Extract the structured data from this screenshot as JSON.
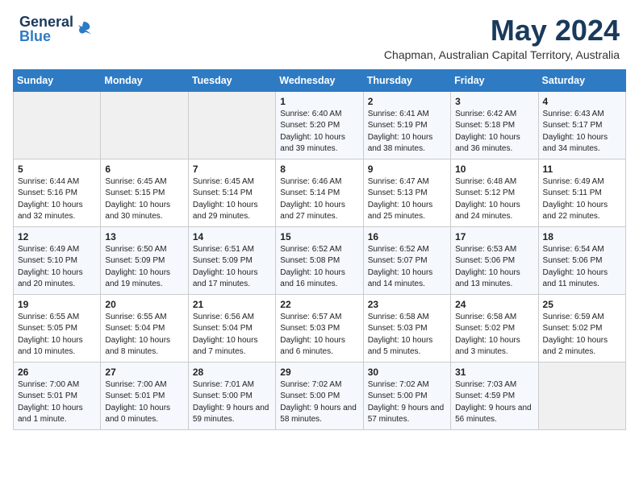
{
  "header": {
    "logo_general": "General",
    "logo_blue": "Blue",
    "month_year": "May 2024",
    "location": "Chapman, Australian Capital Territory, Australia"
  },
  "calendar": {
    "day_headers": [
      "Sunday",
      "Monday",
      "Tuesday",
      "Wednesday",
      "Thursday",
      "Friday",
      "Saturday"
    ],
    "weeks": [
      [
        {
          "day": "",
          "content": ""
        },
        {
          "day": "",
          "content": ""
        },
        {
          "day": "",
          "content": ""
        },
        {
          "day": "1",
          "content": "Sunrise: 6:40 AM\nSunset: 5:20 PM\nDaylight: 10 hours\nand 39 minutes."
        },
        {
          "day": "2",
          "content": "Sunrise: 6:41 AM\nSunset: 5:19 PM\nDaylight: 10 hours\nand 38 minutes."
        },
        {
          "day": "3",
          "content": "Sunrise: 6:42 AM\nSunset: 5:18 PM\nDaylight: 10 hours\nand 36 minutes."
        },
        {
          "day": "4",
          "content": "Sunrise: 6:43 AM\nSunset: 5:17 PM\nDaylight: 10 hours\nand 34 minutes."
        }
      ],
      [
        {
          "day": "5",
          "content": "Sunrise: 6:44 AM\nSunset: 5:16 PM\nDaylight: 10 hours\nand 32 minutes."
        },
        {
          "day": "6",
          "content": "Sunrise: 6:45 AM\nSunset: 5:15 PM\nDaylight: 10 hours\nand 30 minutes."
        },
        {
          "day": "7",
          "content": "Sunrise: 6:45 AM\nSunset: 5:14 PM\nDaylight: 10 hours\nand 29 minutes."
        },
        {
          "day": "8",
          "content": "Sunrise: 6:46 AM\nSunset: 5:14 PM\nDaylight: 10 hours\nand 27 minutes."
        },
        {
          "day": "9",
          "content": "Sunrise: 6:47 AM\nSunset: 5:13 PM\nDaylight: 10 hours\nand 25 minutes."
        },
        {
          "day": "10",
          "content": "Sunrise: 6:48 AM\nSunset: 5:12 PM\nDaylight: 10 hours\nand 24 minutes."
        },
        {
          "day": "11",
          "content": "Sunrise: 6:49 AM\nSunset: 5:11 PM\nDaylight: 10 hours\nand 22 minutes."
        }
      ],
      [
        {
          "day": "12",
          "content": "Sunrise: 6:49 AM\nSunset: 5:10 PM\nDaylight: 10 hours\nand 20 minutes."
        },
        {
          "day": "13",
          "content": "Sunrise: 6:50 AM\nSunset: 5:09 PM\nDaylight: 10 hours\nand 19 minutes."
        },
        {
          "day": "14",
          "content": "Sunrise: 6:51 AM\nSunset: 5:09 PM\nDaylight: 10 hours\nand 17 minutes."
        },
        {
          "day": "15",
          "content": "Sunrise: 6:52 AM\nSunset: 5:08 PM\nDaylight: 10 hours\nand 16 minutes."
        },
        {
          "day": "16",
          "content": "Sunrise: 6:52 AM\nSunset: 5:07 PM\nDaylight: 10 hours\nand 14 minutes."
        },
        {
          "day": "17",
          "content": "Sunrise: 6:53 AM\nSunset: 5:06 PM\nDaylight: 10 hours\nand 13 minutes."
        },
        {
          "day": "18",
          "content": "Sunrise: 6:54 AM\nSunset: 5:06 PM\nDaylight: 10 hours\nand 11 minutes."
        }
      ],
      [
        {
          "day": "19",
          "content": "Sunrise: 6:55 AM\nSunset: 5:05 PM\nDaylight: 10 hours\nand 10 minutes."
        },
        {
          "day": "20",
          "content": "Sunrise: 6:55 AM\nSunset: 5:04 PM\nDaylight: 10 hours\nand 8 minutes."
        },
        {
          "day": "21",
          "content": "Sunrise: 6:56 AM\nSunset: 5:04 PM\nDaylight: 10 hours\nand 7 minutes."
        },
        {
          "day": "22",
          "content": "Sunrise: 6:57 AM\nSunset: 5:03 PM\nDaylight: 10 hours\nand 6 minutes."
        },
        {
          "day": "23",
          "content": "Sunrise: 6:58 AM\nSunset: 5:03 PM\nDaylight: 10 hours\nand 5 minutes."
        },
        {
          "day": "24",
          "content": "Sunrise: 6:58 AM\nSunset: 5:02 PM\nDaylight: 10 hours\nand 3 minutes."
        },
        {
          "day": "25",
          "content": "Sunrise: 6:59 AM\nSunset: 5:02 PM\nDaylight: 10 hours\nand 2 minutes."
        }
      ],
      [
        {
          "day": "26",
          "content": "Sunrise: 7:00 AM\nSunset: 5:01 PM\nDaylight: 10 hours\nand 1 minute."
        },
        {
          "day": "27",
          "content": "Sunrise: 7:00 AM\nSunset: 5:01 PM\nDaylight: 10 hours\nand 0 minutes."
        },
        {
          "day": "28",
          "content": "Sunrise: 7:01 AM\nSunset: 5:00 PM\nDaylight: 9 hours\nand 59 minutes."
        },
        {
          "day": "29",
          "content": "Sunrise: 7:02 AM\nSunset: 5:00 PM\nDaylight: 9 hours\nand 58 minutes."
        },
        {
          "day": "30",
          "content": "Sunrise: 7:02 AM\nSunset: 5:00 PM\nDaylight: 9 hours\nand 57 minutes."
        },
        {
          "day": "31",
          "content": "Sunrise: 7:03 AM\nSunset: 4:59 PM\nDaylight: 9 hours\nand 56 minutes."
        },
        {
          "day": "",
          "content": ""
        }
      ]
    ]
  }
}
